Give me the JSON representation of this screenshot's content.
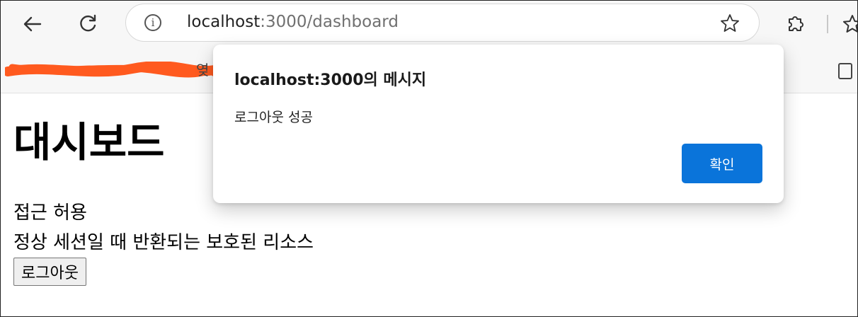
{
  "browser": {
    "address_bar": {
      "url_host": "localhost",
      "url_rest": ":3000/dashboard"
    },
    "bookmarks_bar": {
      "partial_text": "옂"
    }
  },
  "page": {
    "title": "대시보드",
    "access_text": "접근 허용",
    "resource_text": "정상 세션일 때 반환되는 보호된 리소스",
    "logout_label": "로그아웃"
  },
  "dialog": {
    "title": "localhost:3000의 메시지",
    "message": "로그아웃 성공",
    "ok_label": "확인"
  },
  "colors": {
    "dialog_button": "#0a74da",
    "redaction": "#ff5a1f"
  },
  "icons": {
    "back": "back-arrow-icon",
    "reload": "reload-icon",
    "info": "info-icon",
    "favorite": "star-icon",
    "extensions": "puzzle-icon",
    "favorites": "favorites-icon"
  }
}
